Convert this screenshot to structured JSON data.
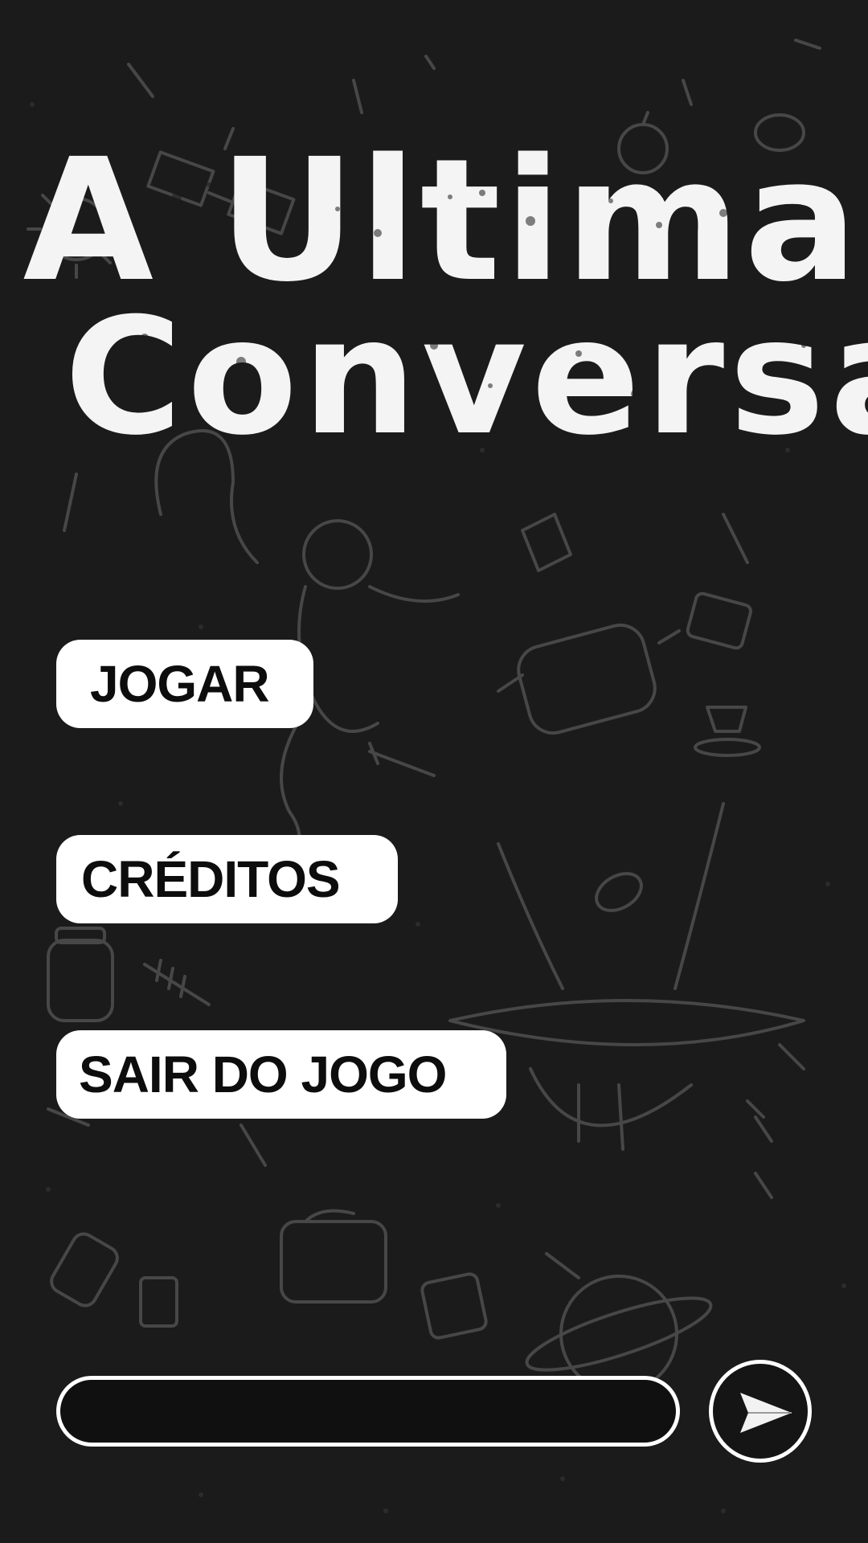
{
  "title": {
    "line1": "A Ultima",
    "line2": "Conversa"
  },
  "menu": {
    "play_label": "JOGAR",
    "credits_label": "CRÉDITOS",
    "quit_label": "SAIR DO JOGO"
  },
  "chat": {
    "input_value": "",
    "placeholder": "",
    "send_icon": "send-arrow-icon"
  },
  "colors": {
    "background": "#1b1b1b",
    "doodle_stroke": "#4a4a4a",
    "button_fill": "#ffffff",
    "button_text": "#0d0d0d",
    "title_text": "#f4f4f4"
  }
}
